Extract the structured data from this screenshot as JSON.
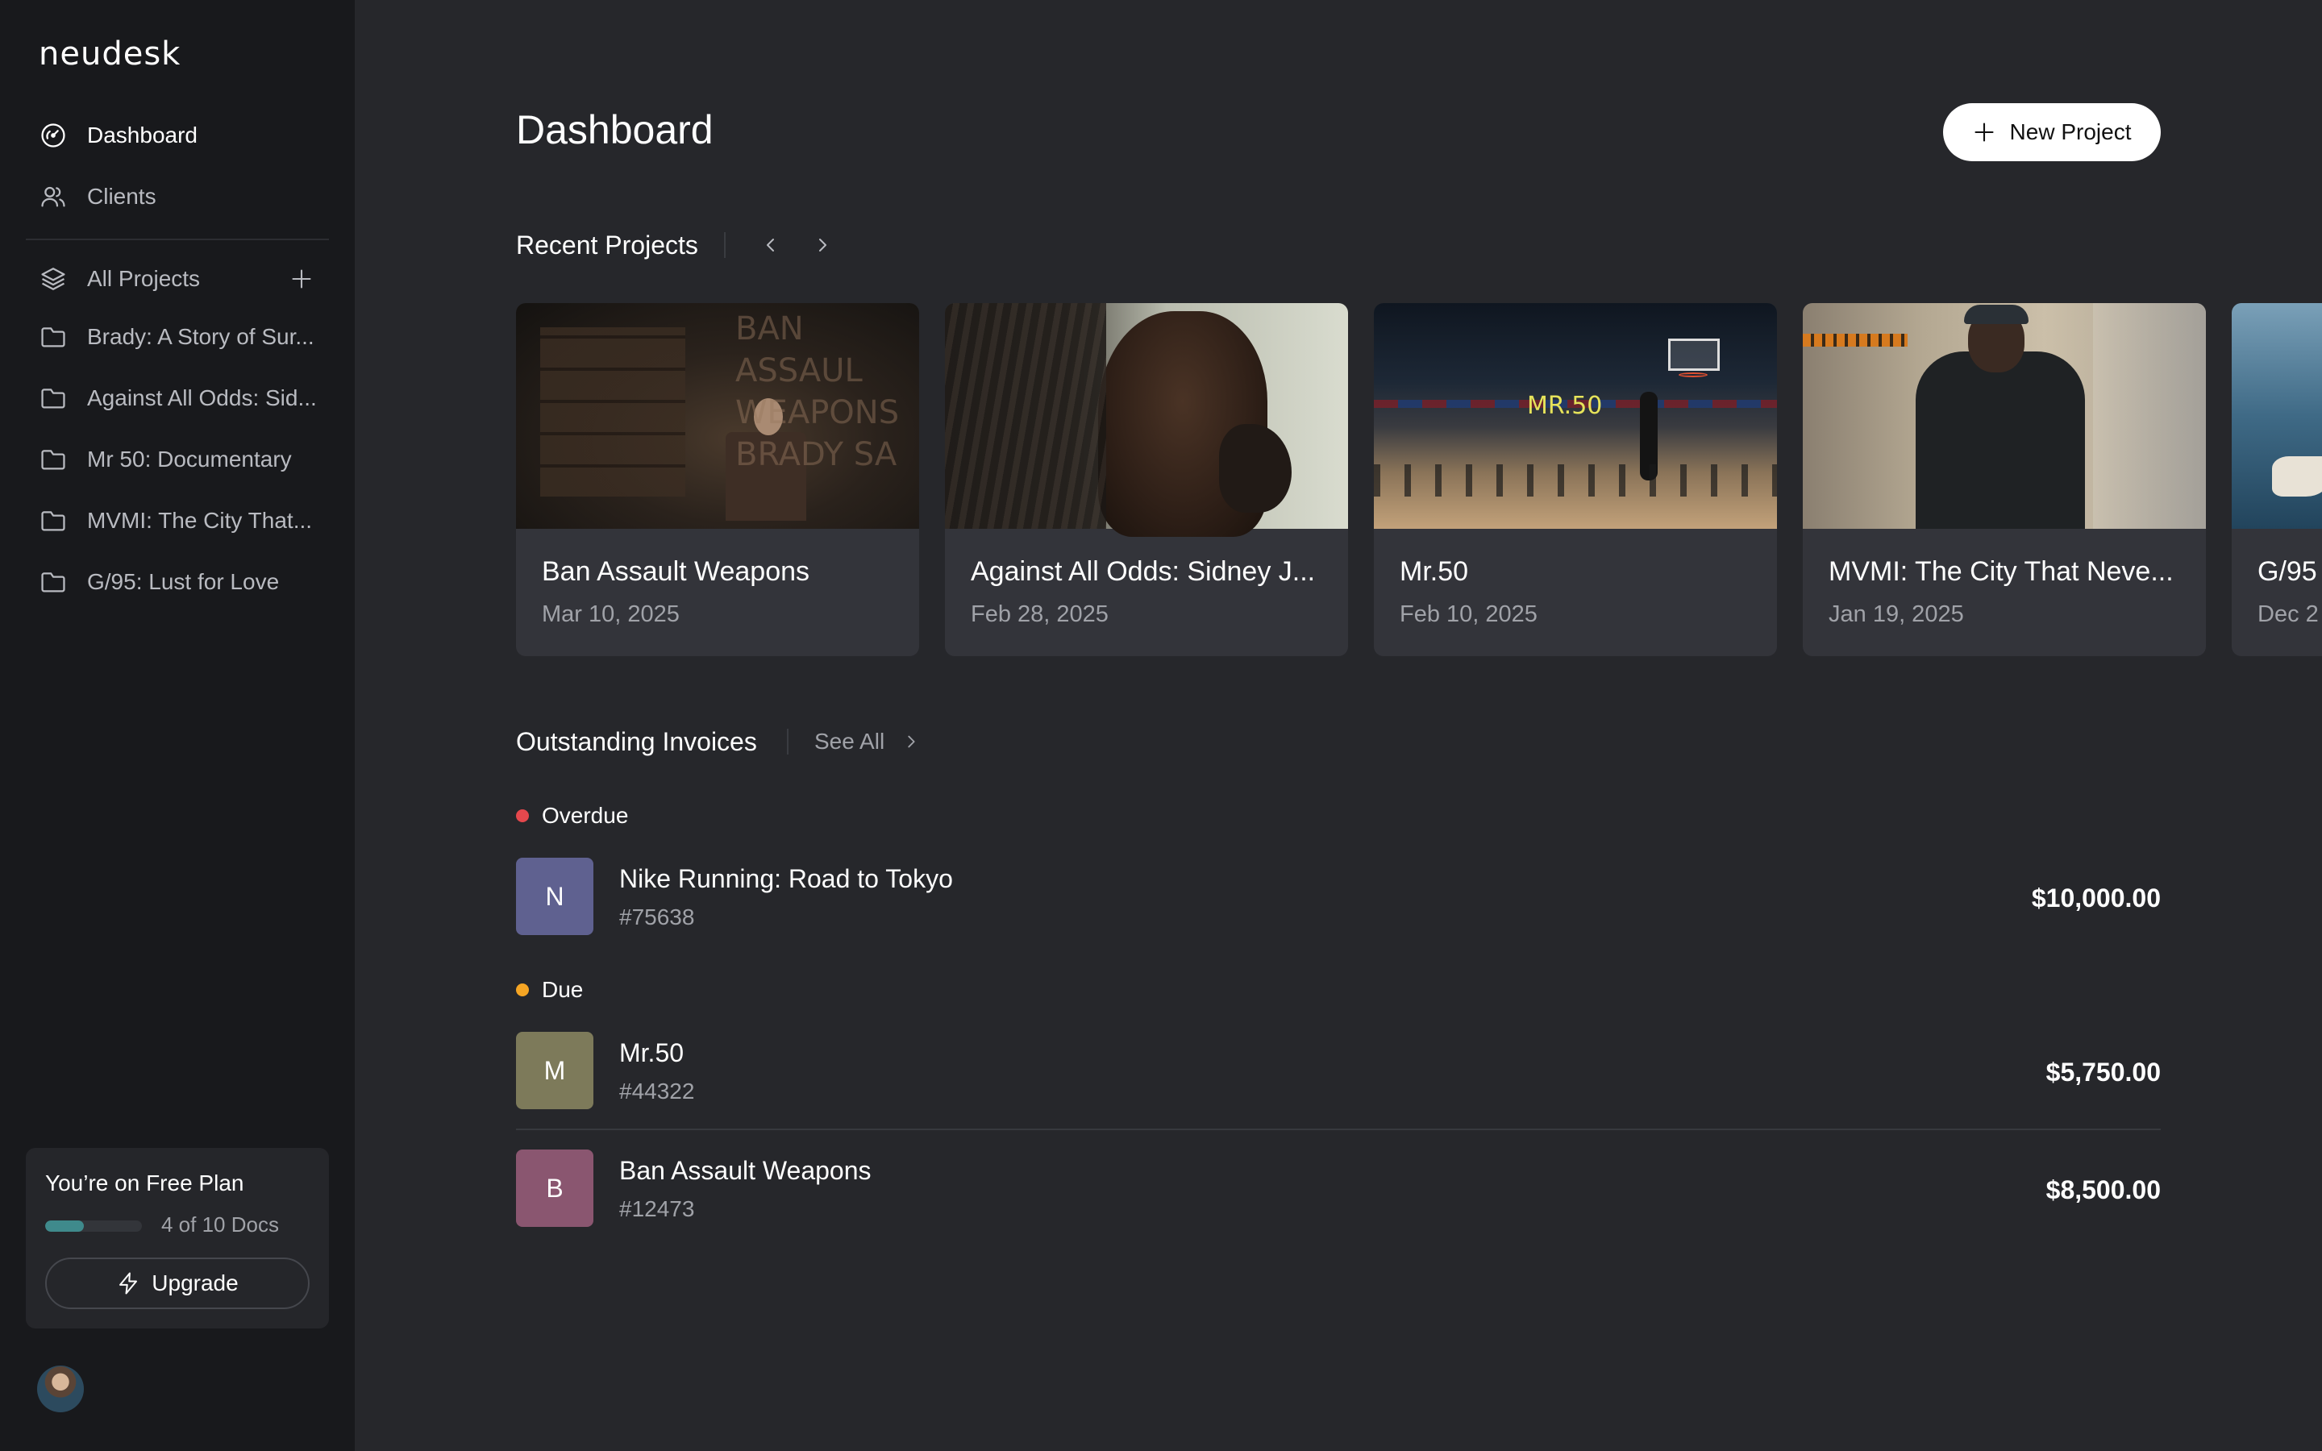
{
  "sidebar": {
    "logo": "neudesk",
    "nav": [
      {
        "label": "Dashboard",
        "icon": "dashboard-gauge-icon",
        "active": true
      },
      {
        "label": "Clients",
        "icon": "users-icon",
        "active": false
      }
    ],
    "projects_header": {
      "label": "All Projects",
      "icon": "layers-icon"
    },
    "projects": [
      {
        "label": "Brady: A Story of Sur...",
        "icon": "folder-icon"
      },
      {
        "label": "Against All Odds: Sid...",
        "icon": "folder-icon"
      },
      {
        "label": "Mr 50: Documentary",
        "icon": "folder-icon"
      },
      {
        "label": "MVMI: The City That...",
        "icon": "folder-icon"
      },
      {
        "label": "G/95: Lust for Love",
        "icon": "folder-icon"
      }
    ],
    "plan": {
      "title": "You’re on Free Plan",
      "usage_text": "4 of 10 Docs",
      "usage_fraction": 0.4,
      "upgrade_label": "Upgrade"
    }
  },
  "main": {
    "title": "Dashboard",
    "new_project_label": "New Project",
    "recent_projects": {
      "title": "Recent Projects",
      "cards": [
        {
          "title": "Ban Assault Weapons",
          "date": "Mar 10, 2025"
        },
        {
          "title": "Against All Odds: Sidney J...",
          "date": "Feb 28, 2025"
        },
        {
          "title": "Mr.50",
          "date": "Feb 10, 2025",
          "overlay": "MR.50"
        },
        {
          "title": "MVMI: The City That Neve...",
          "date": "Jan 19, 2025"
        },
        {
          "title": "G/95",
          "date": "Dec 2"
        }
      ]
    },
    "invoices": {
      "title": "Outstanding Invoices",
      "see_all_label": "See All",
      "groups": [
        {
          "status": "Overdue",
          "status_color": "#e5484d",
          "items": [
            {
              "initial": "N",
              "name": "Nike Running: Road to Tokyo",
              "number": "#75638",
              "amount": "$10,000.00",
              "color": "#5f6190"
            }
          ]
        },
        {
          "status": "Due",
          "status_color": "#f5a524",
          "items": [
            {
              "initial": "M",
              "name": "Mr.50",
              "number": "#44322",
              "amount": "$5,750.00",
              "color": "#7d7a5a"
            },
            {
              "initial": "B",
              "name": "Ban Assault Weapons",
              "number": "#12473",
              "amount": "$8,500.00",
              "color": "#8a5670"
            }
          ]
        }
      ]
    }
  }
}
